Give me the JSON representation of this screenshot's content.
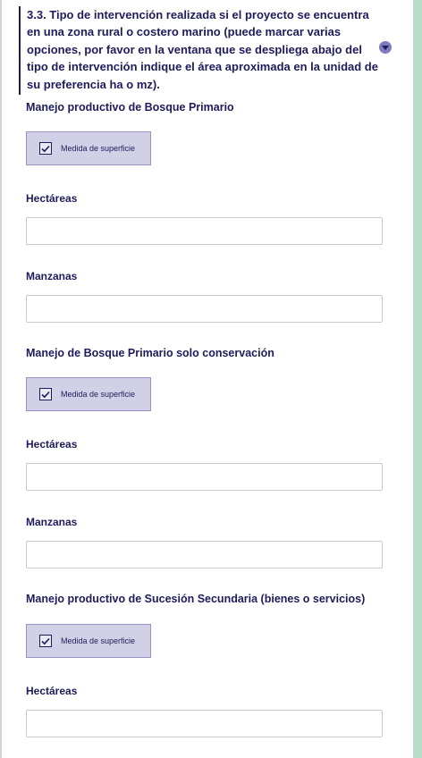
{
  "question": {
    "text": "3.3. Tipo de intervención realizada si el proyecto se encuentra en una zona rural o costero marino (puede marcar varias opciones, por favor en la ventana que se despliega abajo del tipo de intervención indique el área aproximada en la unidad de su preferencia ha o mz)."
  },
  "sections": [
    {
      "title": "Manejo productivo de Bosque Primario",
      "checkbox_label": "Medida de superficie",
      "checked": true,
      "fields": [
        {
          "label": "Hectáreas",
          "value": "",
          "placeholder": ""
        },
        {
          "label": "Manzanas",
          "value": "",
          "placeholder": ""
        }
      ]
    },
    {
      "title": "Manejo de Bosque Primario solo conservación",
      "checkbox_label": "Medida de superficie",
      "checked": true,
      "fields": [
        {
          "label": "Hectáreas",
          "value": "",
          "placeholder": ""
        },
        {
          "label": "Manzanas",
          "value": "",
          "placeholder": ""
        }
      ]
    },
    {
      "title": "Manejo productivo de Sucesión Secundaria (bienes o servicios)",
      "checkbox_label": "Medida de superficie",
      "checked": true,
      "fields": [
        {
          "label": "Hectáreas",
          "value": "",
          "placeholder": ""
        }
      ]
    }
  ],
  "colors": {
    "text": "#1e1c5a",
    "checkbox_bg": "#d1d0e6",
    "toggle": "#7f7bbd",
    "right_band": "#b9dcc8"
  },
  "icons": {
    "toggle": "chevron-down-icon",
    "checkbox": "checkmark-icon"
  }
}
